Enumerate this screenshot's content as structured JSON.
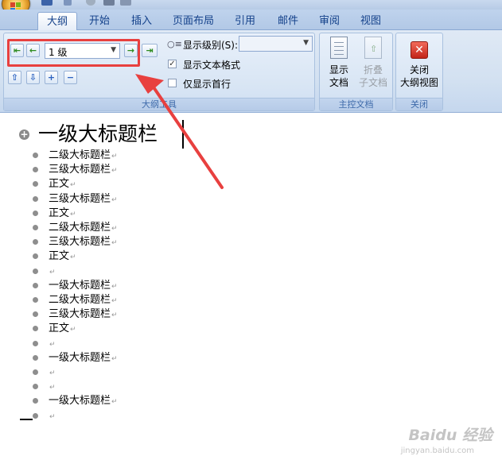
{
  "tabs": [
    "大纲",
    "开始",
    "插入",
    "页面布局",
    "引用",
    "邮件",
    "审阅",
    "视图"
  ],
  "outline_tools": {
    "level_value": "1 级",
    "show_level_label": "显示级别(S):",
    "show_level_value": "",
    "show_text_format_label": "显示文本格式",
    "show_text_format_checked": true,
    "show_first_line_label": "仅显示首行",
    "show_first_line_checked": false,
    "group_label": "大纲工具"
  },
  "master_document": {
    "show_document_line1": "显示",
    "show_document_line2": "文档",
    "collapse_line1": "折叠",
    "collapse_line2": "子文档",
    "group_label": "主控文档"
  },
  "close_group": {
    "close_line1": "关闭",
    "close_line2": "大纲视图",
    "group_label": "关闭"
  },
  "document": {
    "heading1": "一级大标题栏",
    "paragraph_mark": "↵",
    "items": [
      "二级大标题栏",
      "三级大标题栏",
      "正文",
      "三级大标题栏",
      "正文",
      "二级大标题栏",
      "三级大标题栏",
      "正文",
      "",
      "一级大标题栏",
      "二级大标题栏",
      "三级大标题栏",
      "正文",
      "",
      "一级大标题栏",
      "",
      "",
      "一级大标题栏",
      ""
    ]
  },
  "watermark": {
    "text": "Baidu 经验",
    "url_text": "jingyan.baidu.com"
  },
  "colors": {
    "highlight": "#e8403f",
    "ribbon_text": "#15428b"
  }
}
